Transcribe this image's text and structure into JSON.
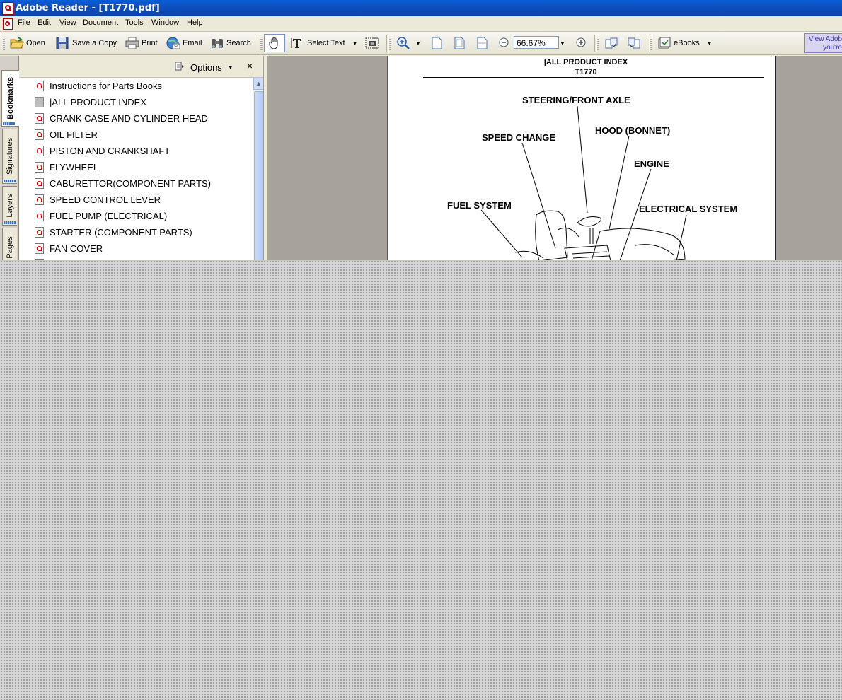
{
  "window": {
    "title": "Adobe Reader - [T1770.pdf]"
  },
  "menubar": {
    "items": [
      "File",
      "Edit",
      "View",
      "Document",
      "Tools",
      "Window",
      "Help"
    ]
  },
  "toolbar": {
    "open_label": "Open",
    "save_label": "Save a Copy",
    "print_label": "Print",
    "email_label": "Email",
    "search_label": "Search",
    "select_text_label": "Select Text",
    "zoom_value": "66.67%",
    "ebooks_label": "eBooks",
    "ad_text_line1": "View Adob",
    "ad_text_line2": "you're"
  },
  "side_tabs": [
    "Bookmarks",
    "Signatures",
    "Layers",
    "Pages"
  ],
  "bookmarks_panel": {
    "options_label": "Options",
    "close_label": "×",
    "items": [
      "Instructions for Parts Books",
      "|ALL PRODUCT INDEX",
      "CRANK CASE AND CYLINDER HEAD",
      "OIL FILTER",
      "PISTON AND CRANKSHAFT",
      "FLYWHEEL",
      "CABURETTOR(COMPONENT PARTS)",
      "SPEED CONTROL LEVER",
      "FUEL PUMP (ELECTRICAL)",
      "STARTER (COMPONENT PARTS)",
      "FAN COVER",
      "V"
    ]
  },
  "document": {
    "heading": "|ALL PRODUCT INDEX",
    "model": "T1770",
    "labels": {
      "steering": "STEERING/FRONT AXLE",
      "speed_change": "SPEED CHANGE",
      "hood": "HOOD (BONNET)",
      "engine": "ENGINE",
      "fuel": "FUEL SYSTEM",
      "electrical": "ELECTRICAL SYSTEM"
    }
  }
}
